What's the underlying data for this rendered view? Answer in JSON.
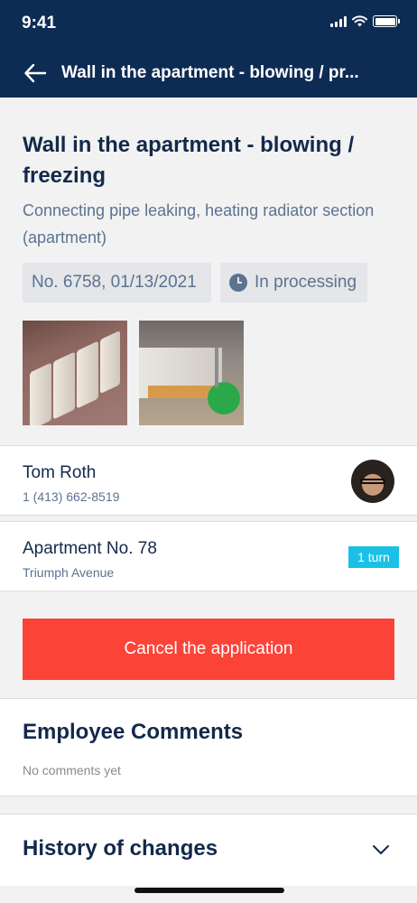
{
  "status_bar": {
    "time": "9:41"
  },
  "nav": {
    "title": "Wall in the apartment - blowing / pr..."
  },
  "request": {
    "title": "Wall in the apartment - blowing / freezing",
    "description": "Connecting pipe leaking, heating radiator section (apartment)",
    "number_date": "No. 6758, 01/13/2021",
    "status": "In processing"
  },
  "contact": {
    "name": "Tom Roth",
    "phone": "1 (413) 662-8519"
  },
  "address": {
    "title": "Apartment No. 78",
    "street": "Triumph Avenue",
    "badge": "1 turn"
  },
  "actions": {
    "cancel_label": "Cancel the application"
  },
  "comments": {
    "title": "Employee Comments",
    "empty_text": "No comments yet"
  },
  "history": {
    "title": "History of changes"
  },
  "colors": {
    "nav_bg": "#0d2c54",
    "cancel_bg": "#fb4338",
    "badge_bg": "#1ac1e6",
    "text_primary": "#13294b",
    "text_secondary": "#5b7390"
  }
}
